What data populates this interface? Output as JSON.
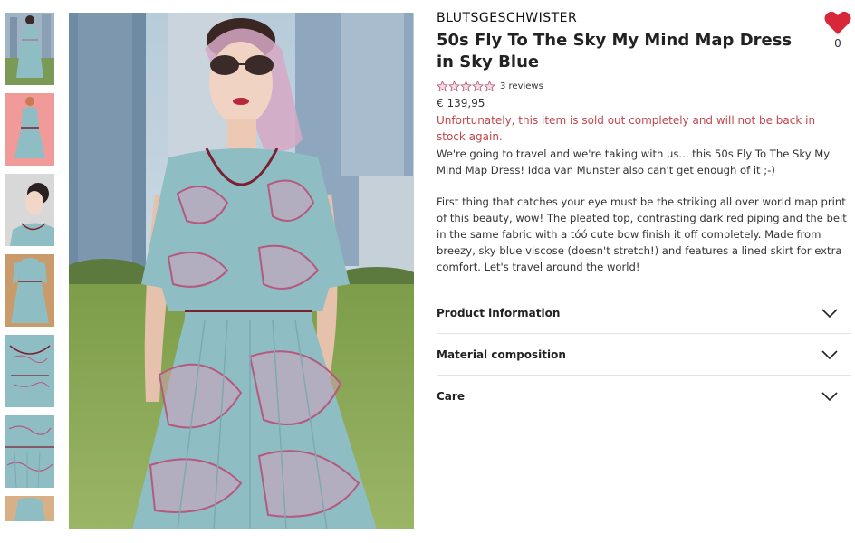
{
  "product": {
    "brand": "BLUTSGESCHWISTER",
    "title": "50s Fly To The Sky My Mind Map Dress in Sky Blue",
    "rating_stars": 0,
    "rating_max": 5,
    "reviews_label": "3 reviews",
    "price": "€ 139,95",
    "soldout_message": "Unfortunately, this item is sold out completely and will not be back in stock again.",
    "description_1": "We're going to travel and we're taking with us... this 50s Fly To The Sky My Mind Map Dress! Idda van Munster also can't get enough of it ;-)",
    "description_2": "First thing that catches your eye must be the striking all over world map print of this beauty, wow! The pleated top, contrasting dark red piping and the belt in the same fabric with a tóó cute bow finish it off completely. Made from breezy, sky blue viscose (doesn't stretch!) and features a lined skirt for extra comfort. Let's travel around the world!"
  },
  "accordion": [
    {
      "label": "Product information",
      "icon": "chevron-down-icon"
    },
    {
      "label": "Material composition",
      "icon": "chevron-down-icon"
    },
    {
      "label": "Care",
      "icon": "chevron-down-icon"
    }
  ],
  "wishlist": {
    "icon": "heart-icon",
    "count": "0",
    "color": "#d62839"
  },
  "colors": {
    "soldout": "#c0454b",
    "dress": "#8fbdc4",
    "map_print": "#b45a7e",
    "piping": "#7a2030"
  },
  "thumbnails": [
    {
      "name": "thumb-1"
    },
    {
      "name": "thumb-2"
    },
    {
      "name": "thumb-3"
    },
    {
      "name": "thumb-4"
    },
    {
      "name": "thumb-5"
    },
    {
      "name": "thumb-6"
    },
    {
      "name": "thumb-7"
    }
  ]
}
